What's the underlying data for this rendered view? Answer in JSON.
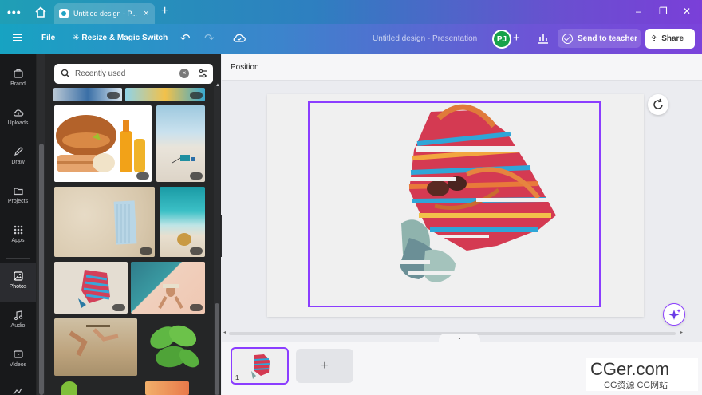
{
  "browser": {
    "tab_title": "Untitled design - P...",
    "tab_close": "×",
    "new_tab": "+",
    "menu_dots": "•••",
    "window_controls": [
      "–",
      "❐",
      "✕"
    ]
  },
  "topbar": {
    "file_label": "File",
    "resize_label": "Resize & Magic Switch",
    "resize_icon": "✳",
    "undo": "↶",
    "redo": "↷",
    "design_title": "Untitled design - Presentation",
    "avatar_initials": "PJ",
    "add_people": "+",
    "send_to_teacher": "Send to teacher",
    "share_label": "Share",
    "share_icon": "⇪"
  },
  "rail": {
    "items": [
      {
        "label": "Brand",
        "icon": "brand-icon"
      },
      {
        "label": "Uploads",
        "icon": "upload-cloud-icon"
      },
      {
        "label": "Draw",
        "icon": "pen-icon"
      },
      {
        "label": "Projects",
        "icon": "folder-icon"
      },
      {
        "label": "Apps",
        "icon": "apps-grid-icon"
      },
      {
        "label": "Photos",
        "icon": "photo-icon"
      },
      {
        "label": "Audio",
        "icon": "music-note-icon"
      },
      {
        "label": "Videos",
        "icon": "video-icon"
      }
    ],
    "active": "Photos"
  },
  "panel": {
    "search_value": "Recently used",
    "clear_icon": "×",
    "collapse_icon": "‹",
    "scroll_up_icon": "▲"
  },
  "canvas": {
    "context_button": "Position",
    "pages_toggle_icon": "⌄",
    "page_number": "1",
    "add_page": "+",
    "scroll_left": "◂",
    "scroll_right": "▸"
  },
  "colors": {
    "accent": "#8b3dff",
    "rail_bg": "#18191b",
    "panel_bg": "#252627",
    "avatar": "#17a24a"
  },
  "watermark": {
    "main": "CGer.com",
    "sub": "CG资源 CG网站"
  }
}
